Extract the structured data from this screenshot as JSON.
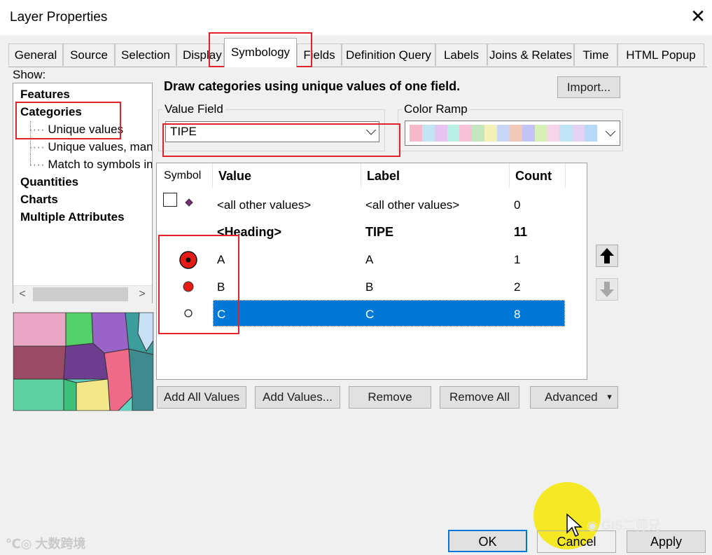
{
  "window": {
    "title": "Layer Properties"
  },
  "tabs": [
    {
      "label": "General"
    },
    {
      "label": "Source"
    },
    {
      "label": "Selection"
    },
    {
      "label": "Display"
    },
    {
      "label": "Symbology"
    },
    {
      "label": "Fields"
    },
    {
      "label": "Definition Query"
    },
    {
      "label": "Labels"
    },
    {
      "label": "Joins & Relates"
    },
    {
      "label": "Time"
    },
    {
      "label": "HTML Popup"
    }
  ],
  "show": {
    "label": "Show:",
    "items": [
      {
        "label": "Features"
      },
      {
        "label": "Categories"
      },
      {
        "label": "Unique values"
      },
      {
        "label": "Unique values, many"
      },
      {
        "label": "Match to symbols in a"
      },
      {
        "label": "Quantities"
      },
      {
        "label": "Charts"
      },
      {
        "label": "Multiple Attributes"
      }
    ]
  },
  "description": "Draw categories using unique values of one field.",
  "import_label": "Import...",
  "value_field": {
    "label": "Value Field",
    "value": "TIPE"
  },
  "color_ramp": {
    "label": "Color Ramp",
    "colors": [
      "#f7b8c9",
      "#c2e4f4",
      "#e6c3f0",
      "#b8f0e3",
      "#f7c2d8",
      "#c4e6c0",
      "#f3f0b8",
      "#c9d6f5",
      "#f0c8b8",
      "#c3c3f7",
      "#d6f0b8",
      "#f7d4e8",
      "#bfe3f7",
      "#e3d3f3",
      "#b8d8f7"
    ]
  },
  "table": {
    "headers": {
      "symbol": "Symbol",
      "value": "Value",
      "label": "Label",
      "count": "Count"
    },
    "rows": [
      {
        "value": "<all other values>",
        "label": "<all other values>",
        "count": "0"
      },
      {
        "value": "<Heading>",
        "label": "TIPE",
        "count": "11"
      },
      {
        "value": "A",
        "label": "A",
        "count": "1"
      },
      {
        "value": "B",
        "label": "B",
        "count": "2"
      },
      {
        "value": "C",
        "label": "C",
        "count": "8"
      }
    ]
  },
  "buttons": {
    "add_all": "Add All Values",
    "add_values": "Add Values...",
    "remove": "Remove",
    "remove_all": "Remove All",
    "advanced": "Advanced"
  },
  "footer": {
    "ok": "OK",
    "cancel": "Cancel",
    "apply": "Apply"
  },
  "watermarks": {
    "left": "大数跨境",
    "right": "GIS二师兄"
  },
  "colors": {
    "selection": "#0078d7",
    "annotation": "#e0222a",
    "symbol_red": "#e41b17"
  }
}
